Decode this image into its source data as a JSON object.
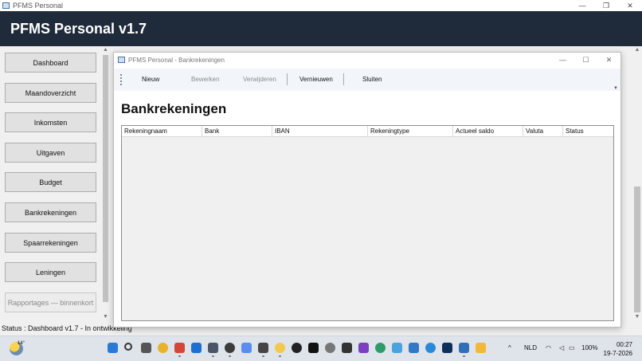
{
  "window": {
    "title": "PFMS Personal",
    "controls": {
      "minimize": "—",
      "maximize": "❐",
      "close": "✕"
    }
  },
  "header": {
    "title": "PFMS Personal v1.7"
  },
  "sidebar": {
    "items": [
      {
        "label": "Dashboard",
        "enabled": true
      },
      {
        "label": "Maandoverzicht",
        "enabled": true
      },
      {
        "label": "Inkomsten",
        "enabled": true
      },
      {
        "label": "Uitgaven",
        "enabled": true
      },
      {
        "label": "Budget",
        "enabled": true
      },
      {
        "label": "Bankrekeningen",
        "enabled": true
      },
      {
        "label": "Spaarrekeningen",
        "enabled": true
      },
      {
        "label": "Leningen",
        "enabled": true
      },
      {
        "label": "Rapportages — binnenkort",
        "enabled": false
      }
    ]
  },
  "status": {
    "text": "Status : Dashboard v1.7 - In ontwikkeling"
  },
  "child_window": {
    "title": "PFMS Personal - Bankrekeningen",
    "controls": {
      "minimize": "—",
      "maximize": "☐",
      "close": "✕"
    },
    "toolbar": {
      "new_label": "Nieuw",
      "edit_label": "Bewerken",
      "delete_label": "Verwijderen",
      "refresh_label": "Vernieuwen",
      "close_label": "Sluiten"
    },
    "page_title": "Bankrekeningen",
    "table": {
      "columns": [
        "Rekeningnaam",
        "Bank",
        "IBAN",
        "Rekeningtype",
        "Actueel saldo",
        "Valuta",
        "Status"
      ],
      "rows": []
    }
  },
  "taskbar": {
    "weather_temp": "14°",
    "tray_up_arrow": "^",
    "language": "NLD",
    "battery": "100%",
    "time": "00:27",
    "date": "19-7-2026"
  },
  "colors": {
    "header_bg": "#1f2b3a",
    "taskbar_bg": "#dfe4ea"
  }
}
